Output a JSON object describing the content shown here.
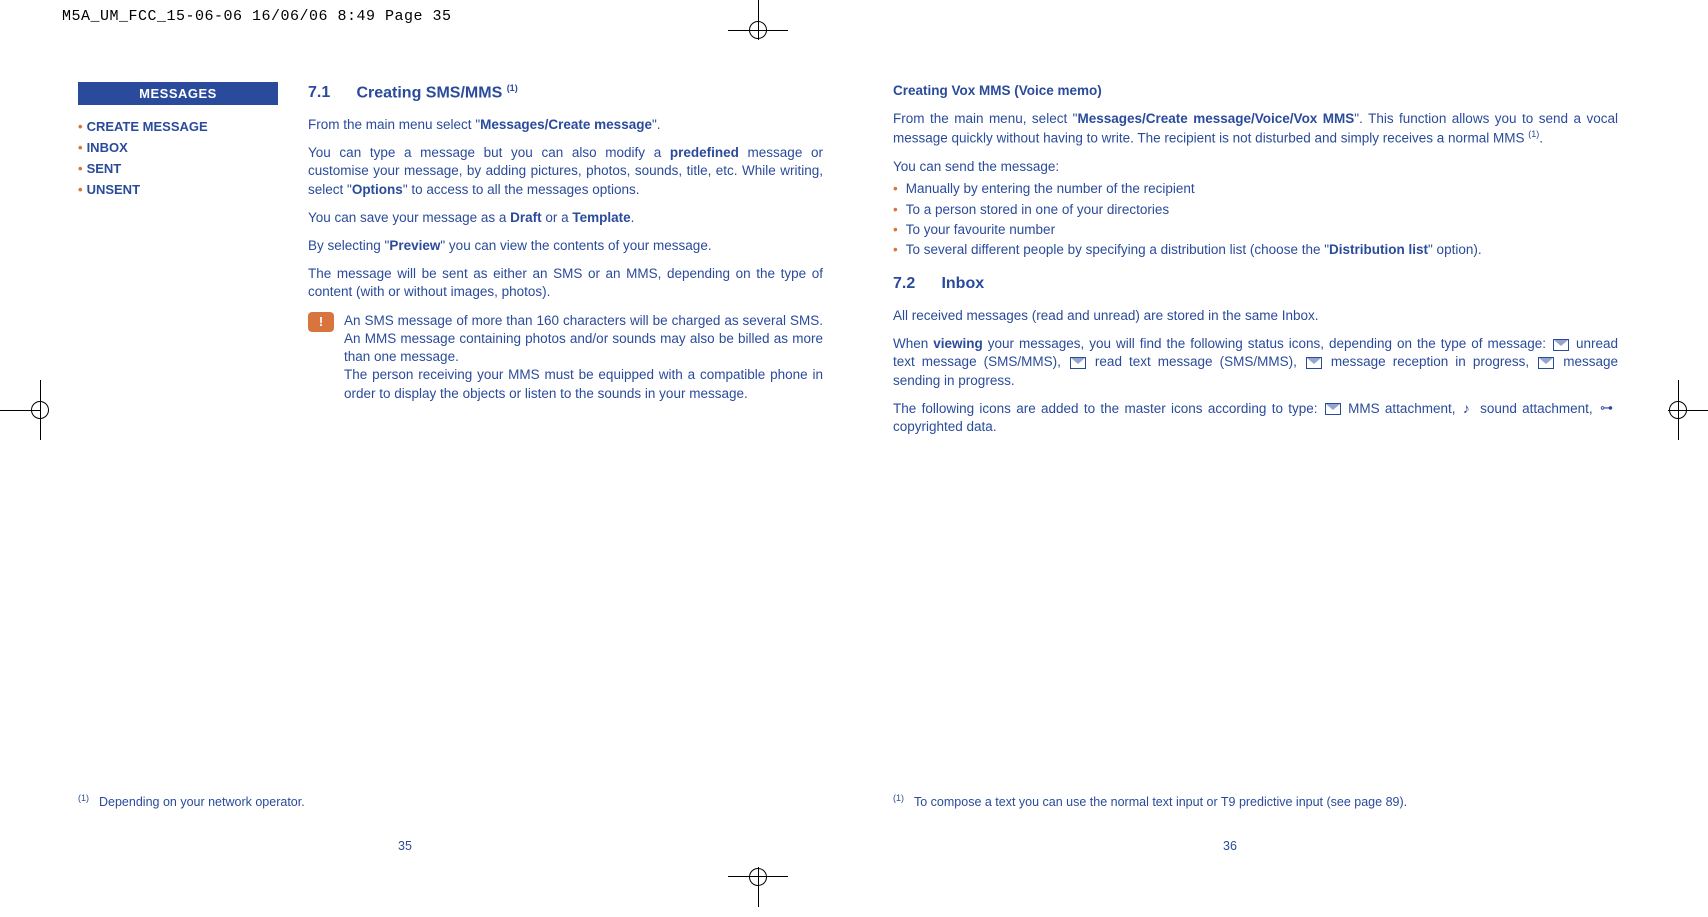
{
  "header_line": "M5A_UM_FCC_15-06-06  16/06/06  8:49  Page 35",
  "sidebar": {
    "title": "MESSAGES",
    "items": [
      "CREATE MESSAGE",
      "INBOX",
      "SENT",
      "UNSENT"
    ]
  },
  "left": {
    "section_num": "7.1",
    "section_title": "Creating SMS/MMS ",
    "section_sup": "(1)",
    "p1_a": "From the main menu select \"",
    "p1_b": "Messages/Create message",
    "p1_c": "\".",
    "p2_a": "You can type a message but you can also modify a ",
    "p2_b": "predefined",
    "p2_c": " message or customise your message, by adding pictures, photos, sounds, title, etc. While writing, select \"",
    "p2_d": "Options",
    "p2_e": "\" to access to all the messages options.",
    "p3_a": "You can save your message as a ",
    "p3_b": "Draft",
    "p3_c": " or a ",
    "p3_d": "Template",
    "p3_e": ".",
    "p4_a": "By selecting \"",
    "p4_b": "Preview",
    "p4_c": "\" you can view the contents of your message.",
    "p5": "The message will be sent as either an SMS or an MMS, depending on the type of content (with or without images, photos).",
    "note1": "An SMS message of more than 160 characters will be charged as several SMS. An MMS message containing photos and/or sounds may also be billed as more than one message.",
    "note2": "The person receiving your MMS must be equipped with a compatible phone in order to display the objects or listen to the sounds in your message.",
    "footnote_sup": "(1)",
    "footnote": "Depending on your network operator.",
    "page_num": "35"
  },
  "right": {
    "sub_head": "Creating Vox MMS (Voice memo)",
    "p1_a": "From the main menu, select \"",
    "p1_b": "Messages/Create message/Voice/Vox MMS",
    "p1_c": "\". This function allows you to send a vocal message quickly without having to write. The recipient is not disturbed and simply receives a normal MMS ",
    "p1_sup": "(1)",
    "p1_d": ".",
    "p2": "You can send the message:",
    "bullets": [
      "Manually by entering the number of the recipient",
      "To a person stored in one of your directories",
      "To your favourite number"
    ],
    "bullet4_a": "To several different people by specifying a distribution list (choose the \"",
    "bullet4_b": "Distribution list",
    "bullet4_c": "\" option).",
    "section_num": "7.2",
    "section_title": "Inbox",
    "p3": "All received messages (read and unread) are stored in the same Inbox.",
    "p4_a": "When ",
    "p4_b": "viewing",
    "p4_c": " your messages, you will find the following status icons, depending on the type of message: ",
    "icon1_txt": " unread text message (SMS/MMS), ",
    "icon2_txt": " read text message (SMS/MMS), ",
    "icon3_txt": " message reception in progress, ",
    "icon4_txt": " message sending in progress.",
    "p5_a": "The following icons are added to the master icons according to type: ",
    "icon5_txt": " MMS attachment, ",
    "icon6_txt": " sound attachment, ",
    "icon7_txt": " copyrighted data.",
    "footnote_sup": "(1)",
    "footnote": "To compose a text you can use the normal text input or T9 predictive input (see page 89).",
    "page_num": "36"
  }
}
